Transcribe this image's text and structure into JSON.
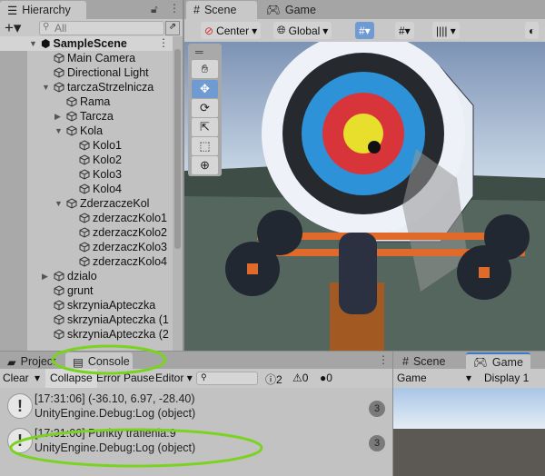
{
  "hierarchy": {
    "title": "Hierarchy",
    "search_placeholder": "All",
    "items": [
      {
        "label": "SampleScene",
        "level": 0,
        "expand": "open",
        "scene": true
      },
      {
        "label": "Main Camera",
        "level": 1
      },
      {
        "label": "Directional Light",
        "level": 1
      },
      {
        "label": "tarczaStrzelnicza",
        "level": 1,
        "expand": "open"
      },
      {
        "label": "Rama",
        "level": 2
      },
      {
        "label": "Tarcza",
        "level": 2,
        "expand": "closed"
      },
      {
        "label": "Kola",
        "level": 2,
        "expand": "open"
      },
      {
        "label": "Kolo1",
        "level": 3
      },
      {
        "label": "Kolo2",
        "level": 3
      },
      {
        "label": "Kolo3",
        "level": 3
      },
      {
        "label": "Kolo4",
        "level": 3
      },
      {
        "label": "ZderzaczeKol",
        "level": 2,
        "expand": "open"
      },
      {
        "label": "zderzaczKolo1",
        "level": 3
      },
      {
        "label": "zderzaczKolo2",
        "level": 3
      },
      {
        "label": "zderzaczKolo3",
        "level": 3
      },
      {
        "label": "zderzaczKolo4",
        "level": 3
      },
      {
        "label": "dzialo",
        "level": 1,
        "expand": "closed"
      },
      {
        "label": "grunt",
        "level": 1
      },
      {
        "label": "skrzyniaApteczka",
        "level": 1
      },
      {
        "label": "skrzyniaApteczka (1",
        "level": 1
      },
      {
        "label": "skrzyniaApteczka (2",
        "level": 1
      }
    ]
  },
  "scene": {
    "tabs": [
      "Scene",
      "Game"
    ],
    "toolbar": {
      "pivot": "Center",
      "space": "Global"
    },
    "tools": [
      "hand-tool",
      "move-tool",
      "rotate-tool",
      "scale-tool",
      "rect-tool",
      "transform-tool"
    ],
    "active_tool": "move-tool"
  },
  "console": {
    "tabs": [
      "Project",
      "Console"
    ],
    "active_tab": "Console",
    "toolbar": {
      "clear": "Clear",
      "collapse": "Collapse",
      "error_pause": "Error Pause",
      "editor": "Editor",
      "log_count": "2",
      "warn_count": "0",
      "error_count": "0"
    },
    "messages": [
      {
        "line1": "[17:31:06] (-36.10, 6.97, -28.40)",
        "line2": "UnityEngine.Debug:Log (object)",
        "count": "3"
      },
      {
        "line1": "[17:31:06] Punkty trafienia:9",
        "line2": "UnityEngine.Debug:Log (object)",
        "count": "3"
      }
    ]
  },
  "game": {
    "tabs": [
      "Scene",
      "Game"
    ],
    "view": "Game",
    "display": "Display 1"
  },
  "colors": {
    "highlight": "#7bd321",
    "accent": "#6f9ad2"
  }
}
